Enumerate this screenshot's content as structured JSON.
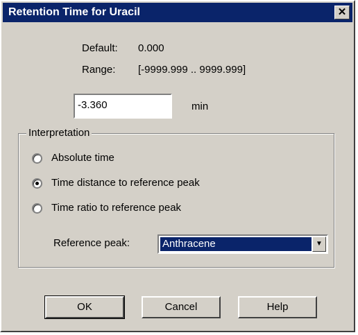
{
  "title": "Retention Time for Uracil",
  "close_glyph": "✕",
  "info": {
    "default_label": "Default:",
    "default_value": "0.000",
    "range_label": "Range:",
    "range_value": "[-9999.999 .. 9999.999]"
  },
  "value_field": {
    "value": "-3.360",
    "unit": "min"
  },
  "interpretation": {
    "label": "Interpretation",
    "options": [
      {
        "label": "Absolute time",
        "checked": false
      },
      {
        "label": "Time distance to reference peak",
        "checked": true
      },
      {
        "label": "Time ratio to reference peak",
        "checked": false
      }
    ],
    "reference_label": "Reference peak:",
    "reference_value": "Anthracene"
  },
  "buttons": {
    "ok": "OK",
    "cancel": "Cancel",
    "help": "Help"
  }
}
